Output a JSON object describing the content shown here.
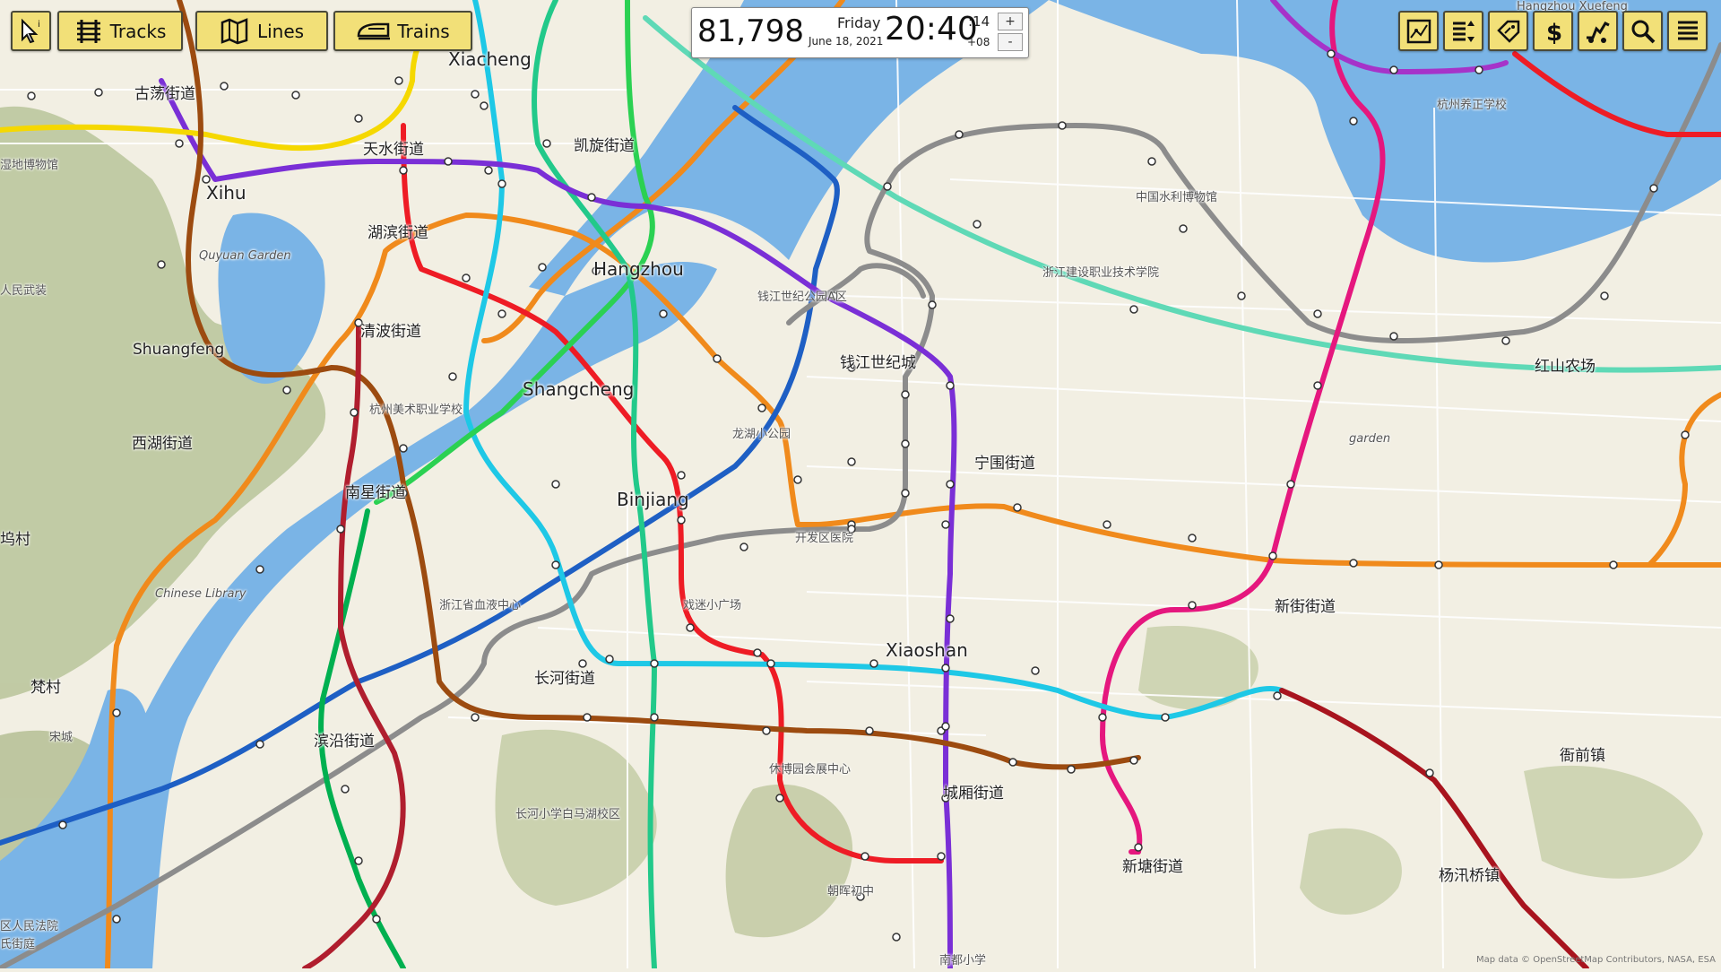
{
  "toolbar": {
    "tracks_label": "Tracks",
    "lines_label": "Lines",
    "trains_label": "Trains"
  },
  "clock": {
    "score": "81,798",
    "day": "Friday",
    "date": "June 18, 2021",
    "time": "20:40",
    "seconds": ":14",
    "timezone": "+08",
    "speed_up": "+",
    "speed_down": "-"
  },
  "right_tools": [
    {
      "icon": "map-layers-icon"
    },
    {
      "icon": "sort-list-icon"
    },
    {
      "icon": "tag-icon"
    },
    {
      "icon": "dollar-icon"
    },
    {
      "icon": "construction-icon"
    },
    {
      "icon": "search-icon"
    },
    {
      "icon": "menu-icon"
    }
  ],
  "map": {
    "place_labels": [
      "Xiacheng",
      "古荡街道",
      "天水街道",
      "凯旋街道",
      "Xihu",
      "湖滨街道",
      "Hangzhou",
      "Quyuan Garden",
      "湿地博物馆",
      "人民武装",
      "清波街道",
      "Shuangfeng",
      "Shangcheng",
      "杭州美术职业学校",
      "西湖街道",
      "南星街道",
      "Binjiang",
      "坞村",
      "Chinese Library",
      "浙江省血液中心",
      "长河街道",
      "戏迷小广场",
      "梵村",
      "宋城",
      "滨沿街道",
      "长河小学白马湖校区",
      "休博园会展中心",
      "朝晖初中",
      "城厢街道",
      "区人民法院",
      "氏街庭",
      "Xiaoshan",
      "南都小学",
      "新塘街道",
      "杨汛桥镇",
      "衙前镇",
      "新街街道",
      "开发区医院",
      "龙湖小公园",
      "钱江世纪公园A区",
      "钱江世纪城",
      "宁围街道",
      "中国水利博物馆",
      "浙江建设职业技术学院",
      "杭州养正学校",
      "红山农场",
      "garden",
      "Hangzhou Xuefeng"
    ],
    "attribution": "Map data © OpenStreetMap Contributors, NASA, ESA"
  },
  "colors": {
    "water": "#7ab4e6",
    "land": "#f2efe3",
    "button": "#f2e078"
  }
}
